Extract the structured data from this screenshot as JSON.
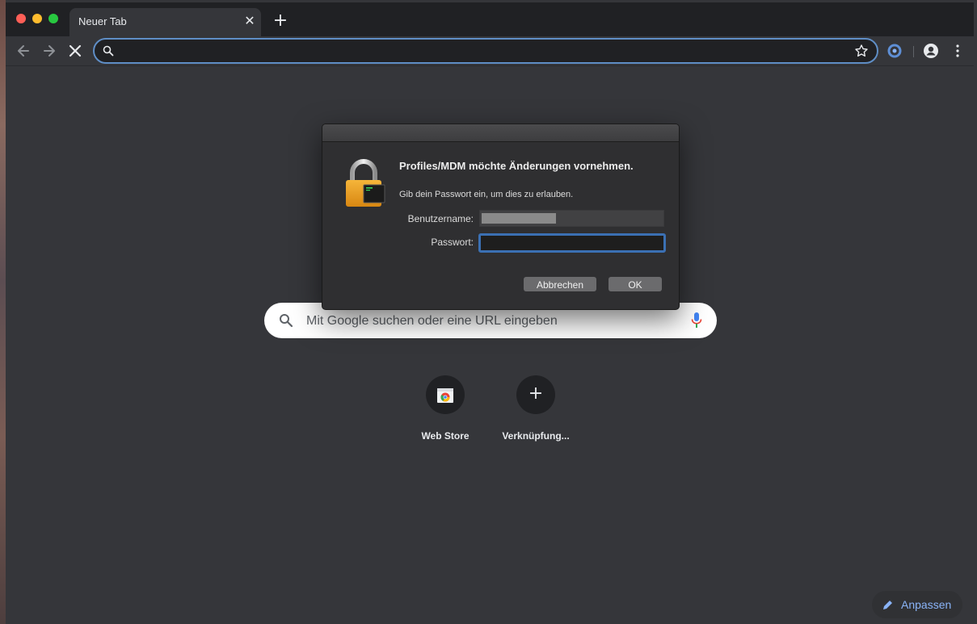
{
  "browser": {
    "tab": {
      "title": "Neuer Tab",
      "close_glyph": "✕"
    },
    "new_tab_glyph": "+",
    "omnibox": {
      "value": ""
    }
  },
  "ntp": {
    "search_placeholder": "Mit Google suchen oder eine URL eingeben",
    "shortcuts": [
      {
        "label": "Web Store"
      },
      {
        "label": "Verknüpfung..."
      }
    ],
    "add_glyph": "+",
    "customize_label": "Anpassen"
  },
  "dialog": {
    "title": "Profiles/MDM möchte Änderungen vornehmen.",
    "message": "Gib dein Passwort ein, um dies zu erlauben.",
    "username_label": "Benutzername:",
    "password_label": "Passwort:",
    "cancel_label": "Abbrechen",
    "ok_label": "OK"
  },
  "colors": {
    "accent": "#8ab4f8",
    "focus_ring": "#3b70b3",
    "background": "#35363a"
  },
  "icons": [
    "back-arrow-icon",
    "forward-arrow-icon",
    "stop-icon",
    "search-icon",
    "star-icon",
    "extension-icon",
    "profile-icon",
    "menu-icon",
    "lock-icon",
    "mic-icon",
    "web-store-icon",
    "plus-icon",
    "pencil-icon"
  ]
}
